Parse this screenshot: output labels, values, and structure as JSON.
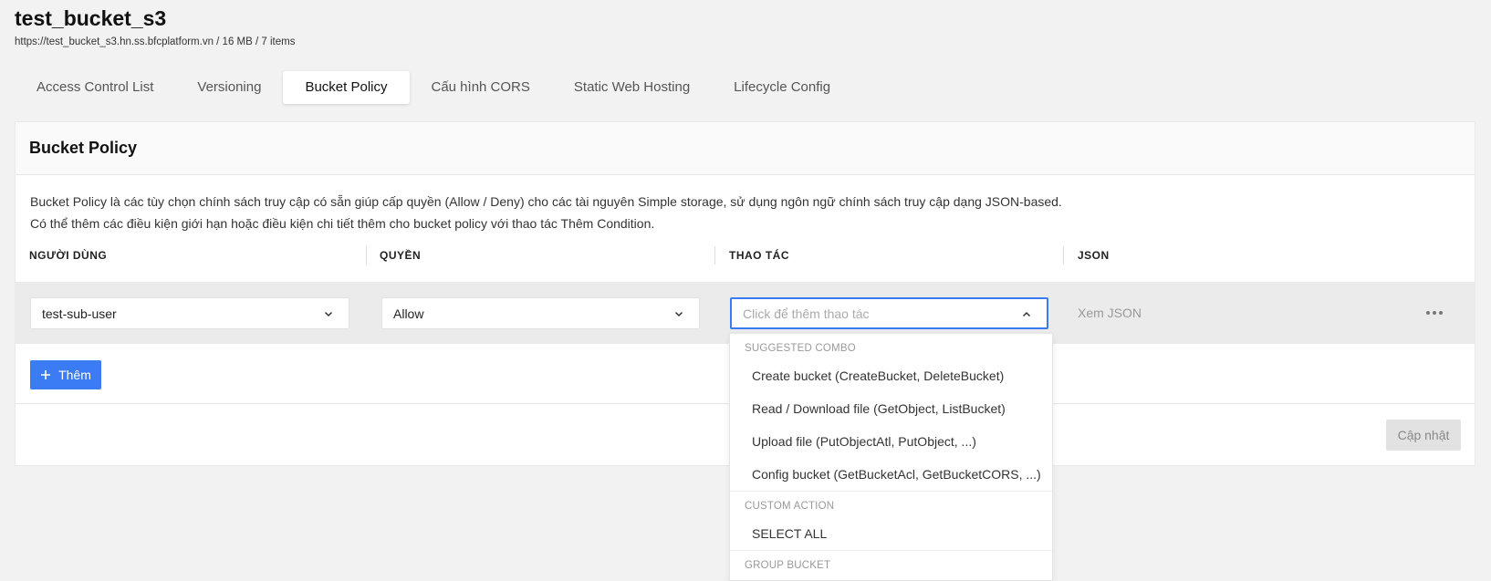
{
  "header": {
    "title": "test_bucket_s3",
    "subtitle": "https://test_bucket_s3.hn.ss.bfcplatform.vn / 16 MB / 7 items"
  },
  "tabs": [
    {
      "label": "Access Control List",
      "active": false
    },
    {
      "label": "Versioning",
      "active": false
    },
    {
      "label": "Bucket Policy",
      "active": true
    },
    {
      "label": "Cấu hình CORS",
      "active": false
    },
    {
      "label": "Static Web Hosting",
      "active": false
    },
    {
      "label": "Lifecycle Config",
      "active": false
    }
  ],
  "card": {
    "title": "Bucket Policy",
    "description_line1": "Bucket Policy là các tùy chọn chính sách truy cập có sẵn giúp cấp quyền (Allow / Deny) cho các tài nguyên Simple storage, sử dụng ngôn ngữ chính sách truy cập dạng JSON-based.",
    "description_line2": "Có thể thêm các điều kiện giới hạn hoặc điều kiện chi tiết thêm cho bucket policy với thao tác Thêm Condition.",
    "columns": [
      "NGƯỜI DÙNG",
      "QUYỀN",
      "THAO TÁC",
      "JSON"
    ],
    "row": {
      "user": "test-sub-user",
      "permission": "Allow",
      "action_placeholder": "Click để thêm thao tác",
      "json_link": "Xem JSON"
    },
    "add_button": "Thêm",
    "update_button": "Cập nhật"
  },
  "dropdown": {
    "groups": [
      {
        "label": "SUGGESTED COMBO",
        "items": [
          "Create bucket (CreateBucket, DeleteBucket)",
          "Read / Download file (GetObject, ListBucket)",
          "Upload file (PutObjectAtl, PutObject, ...)",
          "Config bucket (GetBucketAcl, GetBucketCORS, ...)"
        ]
      },
      {
        "label": "CUSTOM ACTION",
        "items": [
          "SELECT ALL"
        ]
      },
      {
        "label": "GROUP BUCKET",
        "items": []
      }
    ]
  },
  "colors": {
    "primary": "#3b7bf4",
    "focus_border": "#3a7af2",
    "row_bg": "#ebebeb",
    "page_bg": "#f2f2f2"
  },
  "icons": [
    "chevron-down-icon",
    "chevron-up-icon",
    "more-horizontal-icon",
    "plus-icon"
  ]
}
